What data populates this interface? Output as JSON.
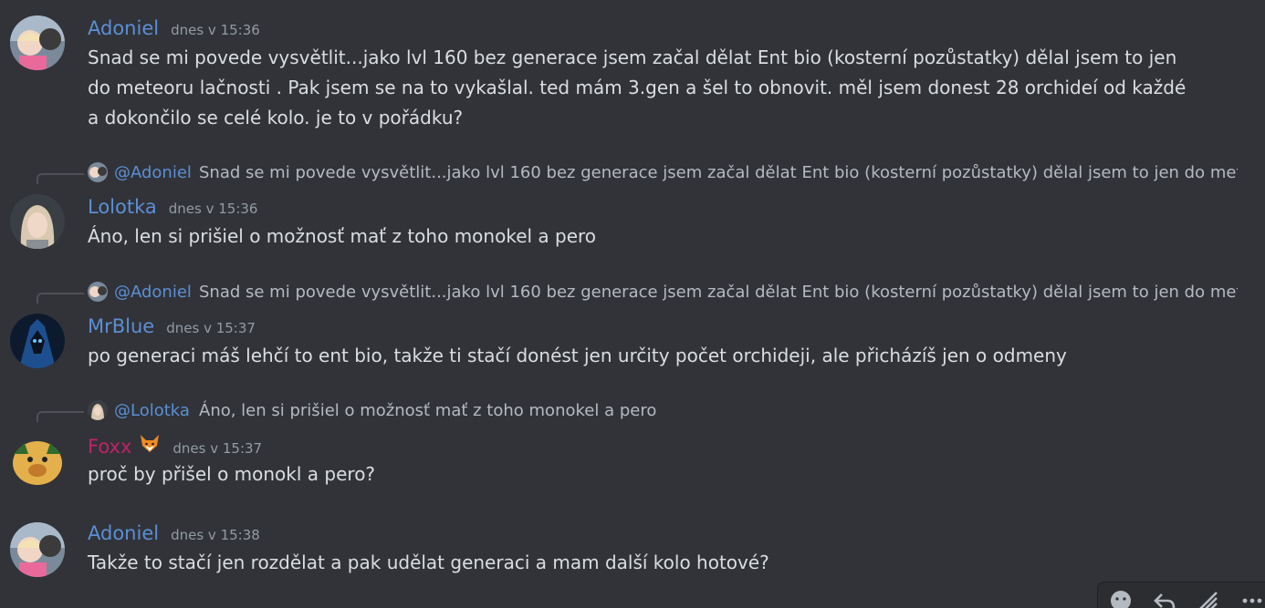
{
  "colors": {
    "background": "#313338",
    "text": "#dbdee1",
    "muted": "#949ba4",
    "adoniel": "#5b8fd6",
    "lolotka": "#5b8fd6",
    "mrblue": "#5b8fd6",
    "foxx": "#c3216a",
    "mention": "#5b8fd6"
  },
  "messages": [
    {
      "author": "Adoniel",
      "timestamp": "dnes v 15:36",
      "content": "Snad se mi povede vysvětlit...jako lvl 160 bez generace jsem začal dělat Ent bio (kosterní pozůstatky) dělal jsem to jen do meteoru lačnosti . Pak jsem se na to vykašlal. ted mám 3.gen a šel to obnovit. měl jsem donest 28 orchideí od každé a dokončilo se celé kolo. je to v pořádku?"
    },
    {
      "reply": {
        "mention": "@Adoniel",
        "text": "Snad se mi povede vysvětlit...jako lvl 160 bez generace jsem začal dělat Ent bio (kosterní pozůstatky) dělal jsem to jen do meteo"
      },
      "author": "Lolotka",
      "timestamp": "dnes v 15:36",
      "content": "Áno, len si prišiel o možnosť mať z toho monokel a pero"
    },
    {
      "reply": {
        "mention": "@Adoniel",
        "text": "Snad se mi povede vysvětlit...jako lvl 160 bez generace jsem začal dělat Ent bio (kosterní pozůstatky) dělal jsem to jen do meteo"
      },
      "author": "MrBlue",
      "timestamp": "dnes v 15:37",
      "content": "po generaci máš lehčí to ent bio, takže ti stačí donést jen určity počet orchideji, ale přicházíš jen o odmeny"
    },
    {
      "reply": {
        "mention": "@Lolotka",
        "text": "Áno, len si prišiel o možnosť mať z toho monokel a pero"
      },
      "author": "Foxx",
      "author_emoji": "fox-face-icon",
      "timestamp": "dnes v 15:37",
      "content": "proč by přišel o monokl a pero?"
    },
    {
      "author": "Adoniel",
      "timestamp": "dnes v 15:38",
      "content": "Takže to stačí jen rozdělat a pak udělat generaci a mam další kolo hotové?"
    }
  ],
  "toolbar": {
    "icons": [
      "add-reaction-icon",
      "reply-icon",
      "forward-icon",
      "more-icon"
    ]
  }
}
